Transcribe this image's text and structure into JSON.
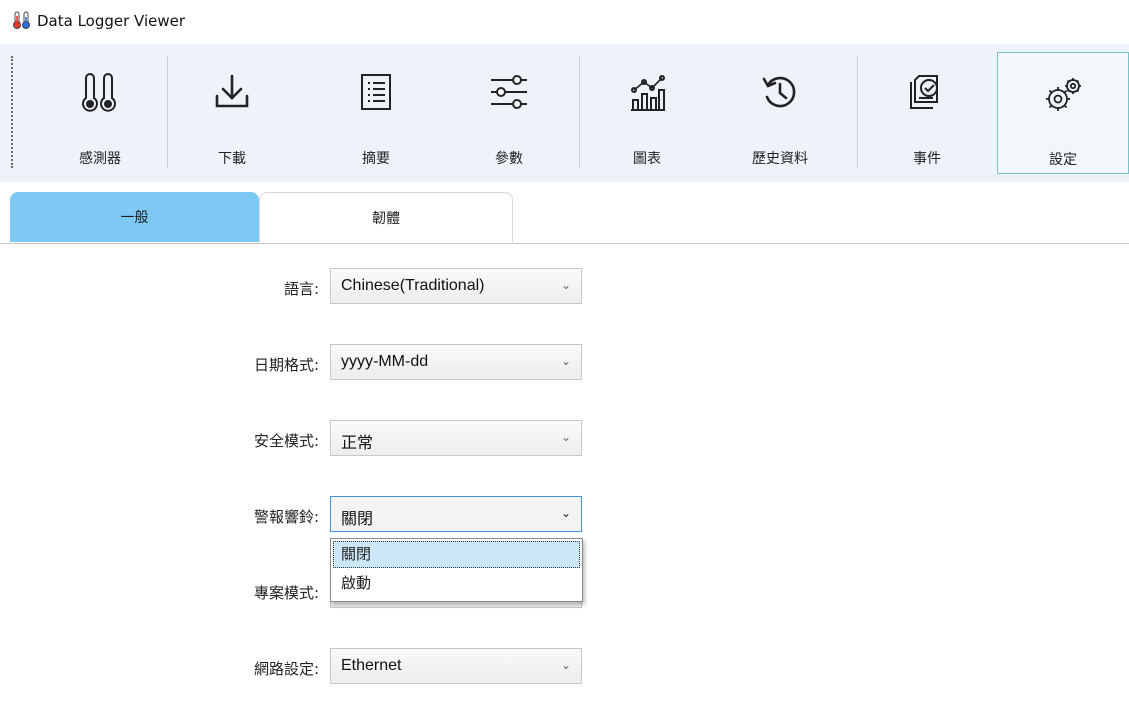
{
  "window": {
    "title": "Data Logger Viewer",
    "icon": "thermometer-icon"
  },
  "toolbar": {
    "items": [
      {
        "label": "感測器",
        "icon": "thermometers-icon"
      },
      {
        "label": "下載",
        "icon": "download-icon"
      },
      {
        "label": "摘要",
        "icon": "summary-icon"
      },
      {
        "label": "參數",
        "icon": "sliders-icon"
      },
      {
        "label": "圖表",
        "icon": "chart-icon"
      },
      {
        "label": "歷史資料",
        "icon": "history-icon"
      },
      {
        "label": "事件",
        "icon": "event-icon"
      },
      {
        "label": "設定",
        "icon": "gears-icon",
        "active": true
      }
    ]
  },
  "tabs": [
    {
      "label": "一般",
      "active": true
    },
    {
      "label": "韌體",
      "active": false
    }
  ],
  "settings": {
    "language": {
      "label": "語言:",
      "value": "Chinese(Traditional)"
    },
    "date_format": {
      "label": "日期格式:",
      "value": "yyyy-MM-dd"
    },
    "security_mode": {
      "label": "安全模式:",
      "value": "正常"
    },
    "alarm_buzzer": {
      "label": "警報響鈴:",
      "value": "關閉",
      "options": [
        "關閉",
        "啟動"
      ],
      "open": true
    },
    "project_mode": {
      "label": "專案模式:",
      "value": ""
    },
    "network": {
      "label": "網路設定:",
      "value": "Ethernet"
    }
  },
  "colors": {
    "active_tab": "#7ec8f5",
    "toolbar_bg": "#eef3fa",
    "dropdown_highlight": "#cce8f8"
  }
}
